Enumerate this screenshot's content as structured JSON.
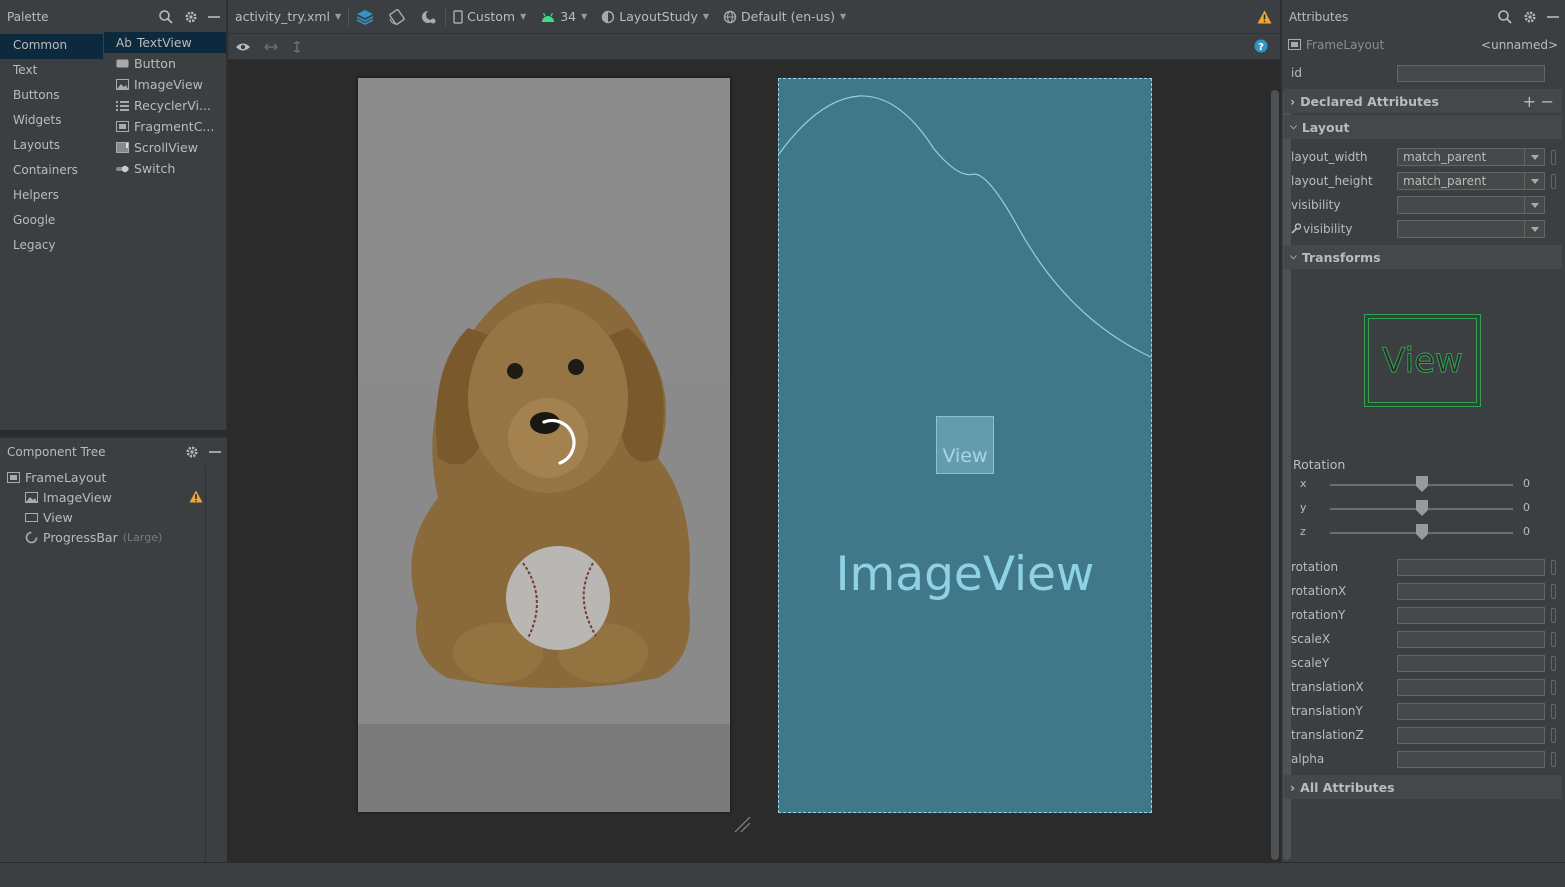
{
  "palette": {
    "title": "Palette",
    "categories": [
      "Common",
      "Text",
      "Buttons",
      "Widgets",
      "Layouts",
      "Containers",
      "Helpers",
      "Google",
      "Legacy"
    ],
    "items": [
      {
        "prefix": "Ab",
        "label": "TextView",
        "icon": "text-icon"
      },
      {
        "label": "Button",
        "icon": "button-icon"
      },
      {
        "label": "ImageView",
        "icon": "image-icon"
      },
      {
        "label": "RecyclerVi...",
        "icon": "list-icon"
      },
      {
        "label": "FragmentC...",
        "icon": "fragment-icon"
      },
      {
        "label": "ScrollView",
        "icon": "scrollview-icon"
      },
      {
        "label": "Switch",
        "icon": "switch-icon"
      }
    ]
  },
  "component_tree": {
    "title": "Component Tree",
    "nodes": [
      {
        "label": "FrameLayout",
        "icon": "framelayout-icon"
      },
      {
        "label": "ImageView",
        "icon": "image-icon",
        "warning": true
      },
      {
        "label": "View",
        "icon": "view-icon"
      },
      {
        "label": "ProgressBar",
        "suffix": "(Large)",
        "icon": "progressbar-icon"
      }
    ]
  },
  "toolbar": {
    "file": "activity_try.xml",
    "device": "Custom",
    "api": "34",
    "theme": "LayoutStudy",
    "locale": "Default (en-us)"
  },
  "blueprint": {
    "imageview_label": "ImageView",
    "view_label": "View"
  },
  "attributes": {
    "title": "Attributes",
    "component": "FrameLayout",
    "component_id": "<unnamed>",
    "id_label": "id",
    "sections": {
      "declared": "Declared Attributes",
      "layout": "Layout",
      "transforms": "Transforms",
      "all": "All Attributes"
    },
    "layout_rows": [
      {
        "label": "layout_width",
        "value": "match_parent"
      },
      {
        "label": "layout_height",
        "value": "match_parent"
      },
      {
        "label": "visibility",
        "value": ""
      },
      {
        "label": "visibility",
        "value": "",
        "tool": true
      }
    ],
    "preview_label": "View",
    "rotation_label": "Rotation",
    "rotation_sliders": [
      {
        "axis": "x",
        "value": "0"
      },
      {
        "axis": "y",
        "value": "0"
      },
      {
        "axis": "z",
        "value": "0"
      }
    ],
    "transform_fields": [
      "rotation",
      "rotationX",
      "rotationY",
      "scaleX",
      "scaleY",
      "translationX",
      "translationY",
      "translationZ",
      "alpha"
    ]
  },
  "colors": {
    "accent": "#3592c4",
    "warning": "#f0a732",
    "blueprint": "#417889",
    "preview_green": "#2fa34f"
  }
}
